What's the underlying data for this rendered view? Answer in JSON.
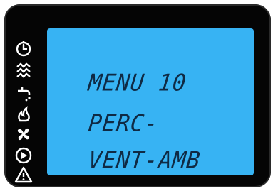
{
  "display": {
    "lines": [
      "MENU 10",
      "PERC-",
      "VENT-AMB"
    ]
  },
  "icons": [
    {
      "name": "clock-icon"
    },
    {
      "name": "heating-icon"
    },
    {
      "name": "sanitary-water-icon"
    },
    {
      "name": "fan-icon"
    },
    {
      "name": "play-icon"
    },
    {
      "name": "warning-icon"
    }
  ],
  "colors": {
    "screen": "#37b3f3",
    "text": "#0f2a44",
    "bezel": "#050505",
    "icon": "#ffffff"
  }
}
